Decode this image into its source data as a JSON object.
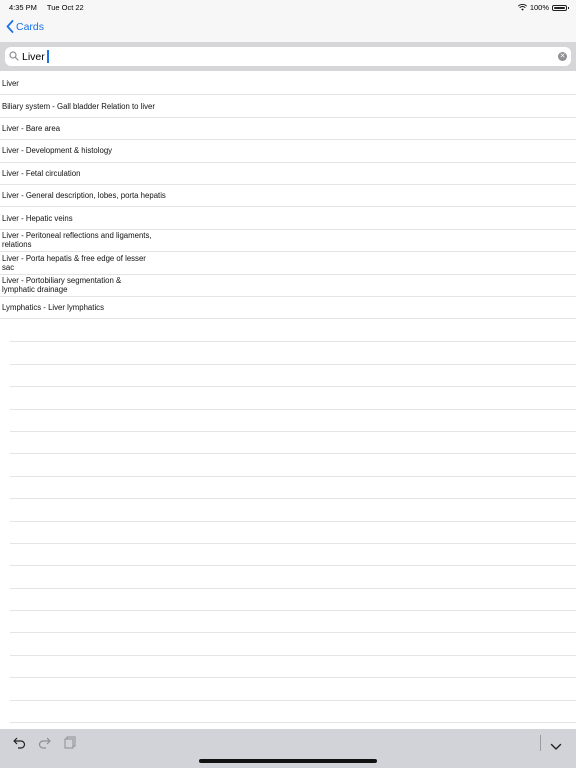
{
  "status_bar": {
    "time": "4:35 PM",
    "date": "Tue Oct 22",
    "battery": "100%",
    "battery_level": 1.0
  },
  "nav": {
    "back_label": "Cards"
  },
  "search": {
    "value": "Liver",
    "placeholder": ""
  },
  "results": [
    {
      "label": "Liver"
    },
    {
      "label": "Biliary system - Gall bladder Relation to liver"
    },
    {
      "label": "Liver - Bare area"
    },
    {
      "label": "Liver - Development & histology"
    },
    {
      "label": "Liver - Fetal circulation"
    },
    {
      "label": "Liver - General description, lobes, porta hepatis"
    },
    {
      "label": "Liver - Hepatic veins"
    },
    {
      "label": "Liver - Peritoneal reflections and ligaments, relations"
    },
    {
      "label": "Liver - Porta hepatis & free edge of lesser sac"
    },
    {
      "label": "Liver - Portobiliary segmentation & lymphatic drainage"
    },
    {
      "label": "Lymphatics - Liver lymphatics"
    }
  ],
  "icons": {
    "back": "chevron-left-icon",
    "search": "magnifier-icon",
    "clear": "clear-icon",
    "undo": "undo-icon",
    "redo": "redo-icon",
    "paste": "clipboard-icon",
    "dismiss": "chevron-down-icon"
  },
  "colors": {
    "accent": "#1a73e8",
    "toolbar": "#d2d3d8",
    "search_bg": "#d6d6d8"
  }
}
